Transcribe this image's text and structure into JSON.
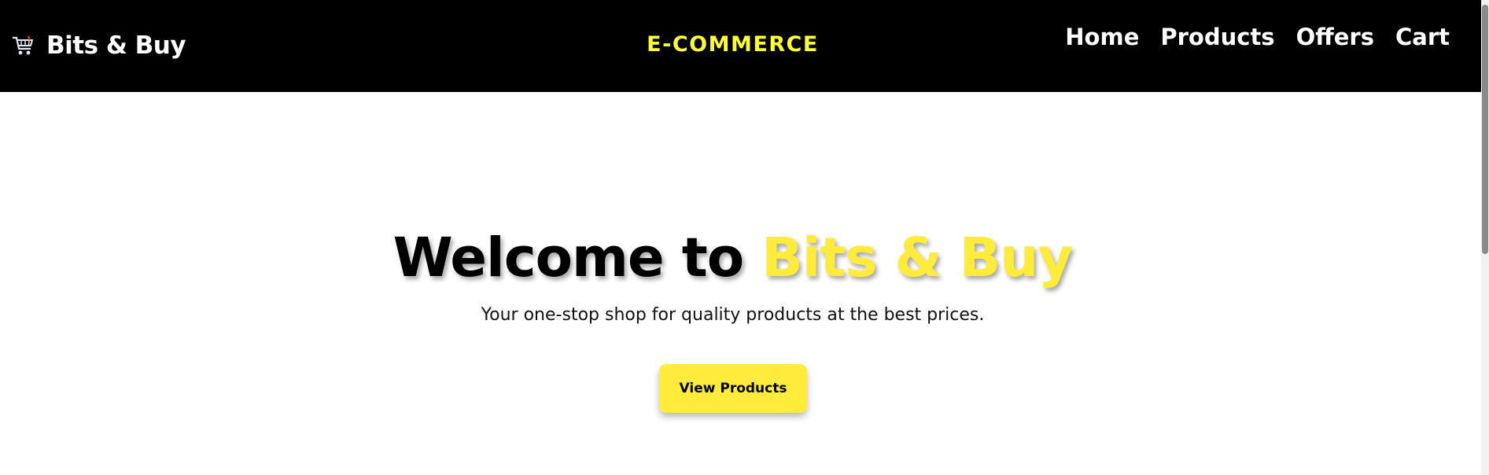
{
  "header": {
    "brand_icon": "shopping-cart-icon",
    "brand_name": "Bits & Buy",
    "center_title": "E-COMMERCE",
    "nav": [
      "Home",
      "Products",
      "Offers",
      "Cart"
    ]
  },
  "hero": {
    "title_prefix": "Welcome to",
    "title_accent": "Bits & Buy",
    "subtitle": "Your one-stop shop for quality products at the best prices.",
    "cta_label": "View Products"
  },
  "colors": {
    "navbar_bg": "#000000",
    "accent_yellow": "#ffeb3b",
    "center_title_yellow": "#ffff33",
    "text_white": "#ffffff"
  }
}
